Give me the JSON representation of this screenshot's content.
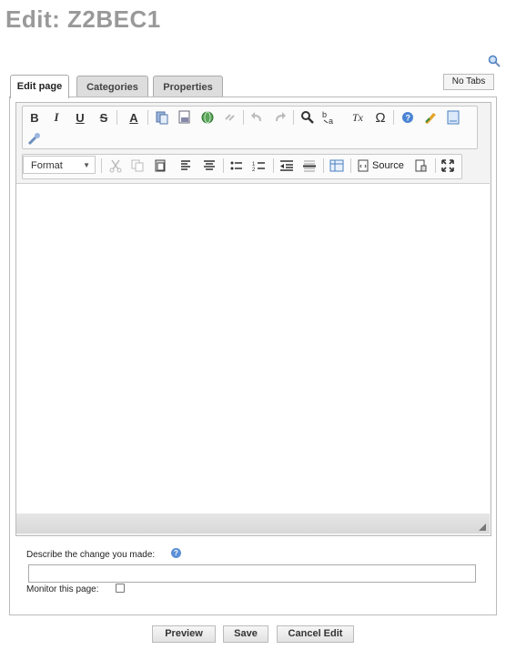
{
  "page": {
    "title": "Edit: Z2BEC1"
  },
  "tabs": {
    "edit_page": "Edit page",
    "categories": "Categories",
    "properties": "Properties",
    "no_tabs": "No Tabs"
  },
  "toolbar1": {
    "bold": "B",
    "italic": "I",
    "underline": "U",
    "strike": "S",
    "text_color": "A",
    "remove_format": "Tx",
    "special_char": "Ω"
  },
  "toolbar2": {
    "format_label": "Format",
    "source_label": "Source"
  },
  "form": {
    "describe_label": "Describe the change you made:",
    "summary_value": "",
    "monitor_label": "Monitor this page:"
  },
  "buttons": {
    "preview": "Preview",
    "save": "Save",
    "cancel": "Cancel Edit"
  }
}
